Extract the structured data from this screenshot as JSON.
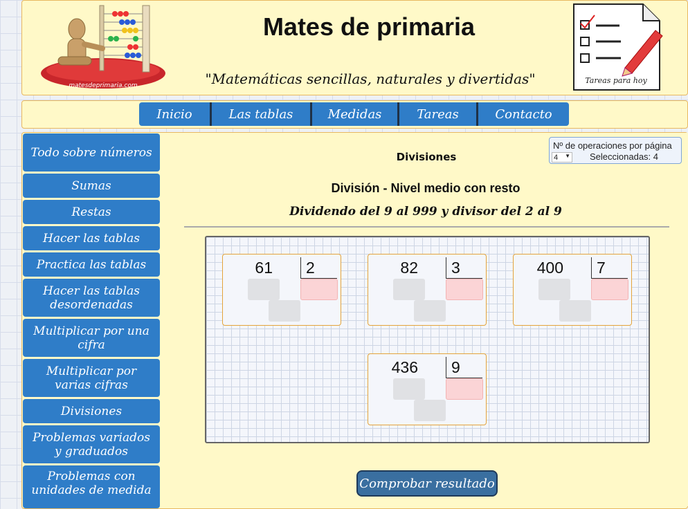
{
  "header": {
    "site_title": "Mates de primaria",
    "tagline": "\"Matemáticas sencillas, naturales y divertidas\"",
    "logo_alt": "matesdeprimaria.com",
    "tasks_label": "Tareas para hoy"
  },
  "nav": {
    "items": [
      {
        "label": "Inicio"
      },
      {
        "label": "Las tablas"
      },
      {
        "label": "Medidas"
      },
      {
        "label": "Tareas"
      },
      {
        "label": "Contacto"
      }
    ]
  },
  "sidebar": {
    "items": [
      {
        "label": "Todo sobre números"
      },
      {
        "label": "Sumas"
      },
      {
        "label": "Restas"
      },
      {
        "label": "Hacer las tablas"
      },
      {
        "label": "Practica las tablas"
      },
      {
        "label": "Hacer las tablas desordenadas"
      },
      {
        "label": "Multiplicar por una cifra"
      },
      {
        "label": "Multiplicar por varias cifras"
      },
      {
        "label": "Divisiones"
      },
      {
        "label": "Problemas variados y graduados"
      },
      {
        "label": "Problemas con unidades de medida"
      }
    ]
  },
  "main": {
    "heading": "Divisiones",
    "ops_per_page": {
      "title": "Nº de operaciones por página",
      "selected_value": "4",
      "selected_text": "Seleccionadas: 4"
    },
    "level_title": "División - Nivel medio con resto",
    "level_subtitle": "Dividendo del 9 al 999 y divisor del 2 al 9",
    "operations": [
      {
        "dividend": "61",
        "divisor": "2"
      },
      {
        "dividend": "82",
        "divisor": "3"
      },
      {
        "dividend": "400",
        "divisor": "7"
      },
      {
        "dividend": "436",
        "divisor": "9"
      }
    ],
    "check_button": "Comprobar resultado"
  },
  "colors": {
    "accent_blue": "#2f7dc8",
    "panel_yellow": "#fff9c8",
    "panel_border": "#e8b860",
    "card_border": "#e4a43a"
  }
}
